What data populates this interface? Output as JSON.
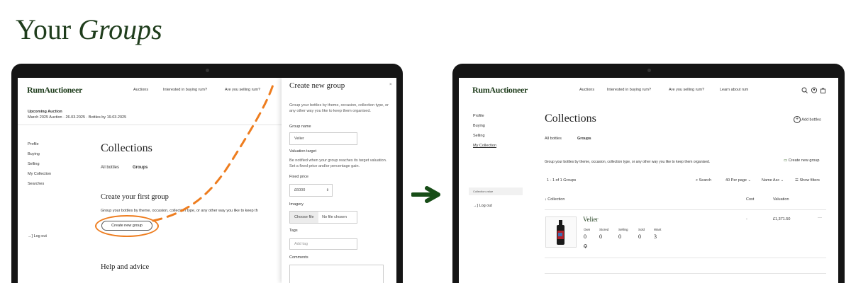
{
  "heading": {
    "plain": "Your",
    "italic": "Groups"
  },
  "left": {
    "logo": "RumAuctioneer",
    "nav": [
      "Auctions",
      "Interested in buying rum?",
      "Are you selling rum?"
    ],
    "upcoming": {
      "label": "Upcoming Auction",
      "detail": "March 2025 Auction  ·  26.03.2025  ·  Bottles by 19.03.2025"
    },
    "sidebar": [
      "Profile",
      "Buying",
      "Selling",
      "My Collection",
      "Searches"
    ],
    "logout": "Log out",
    "title": "Collections",
    "tabs": [
      "All bottles",
      "Groups"
    ],
    "empty_title": "Create your first group",
    "empty_desc": "Group your bottles by theme, occasion, collection type, or any other way you like to keep th",
    "create_button": "Create new group",
    "help_title": "Help and advice",
    "panel": {
      "title": "Create new group",
      "close": "×",
      "desc": [
        "Group your bottles by theme, occasion, collection type, or",
        "any other way you like to keep them organised."
      ],
      "group_name_label": "Group name",
      "group_name_value": "Velier",
      "valuation_label": "Valuation target",
      "valuation_desc": [
        "Be notified when your group reaches its target valuation.",
        "Set a fixed price and/or percentage gain."
      ],
      "fixed_price_label": "Fixed price",
      "fixed_price_value": "£6000",
      "imagery_label": "Imagery",
      "choose_file": "Choose file",
      "no_file": "No file chosen",
      "tags_label": "Tags",
      "tags_placeholder": "Add tag",
      "comments_label": "Comments"
    }
  },
  "right": {
    "logo": "RumAuctioneer",
    "nav": [
      "Auctions",
      "Interested in buying rum?",
      "Are you selling rum?",
      "Learn about rum"
    ],
    "sidebar": [
      "Profile",
      "Buying",
      "Selling",
      "My Collection"
    ],
    "sidebar_extra": "Collection value",
    "logout": "Log out",
    "title": "Collections",
    "add_bottles": "Add bottles",
    "tabs": [
      "All bottles",
      "Groups"
    ],
    "desc": "Group your bottles by theme, occasion, collection type, or any other way you like to keep them organised.",
    "create_group": "Create new group",
    "count": "1 - 1 of 1 Groups",
    "search": "Search",
    "per_page": "40 Per page",
    "sort": "Name Asc",
    "filters": "Show filters",
    "columns": {
      "collection": "↓ Collection",
      "cost": "Cost",
      "valuation": "Valuation"
    },
    "row": {
      "name": "Velier",
      "cost": "-",
      "valuation": "£1,371.50",
      "more": "···",
      "stats_labels": [
        "Own",
        "Stored",
        "Selling",
        "Sold",
        "Want"
      ],
      "stats_values": [
        "0",
        "0",
        "0",
        "0",
        "3"
      ]
    }
  },
  "colors": {
    "brand_green": "#1f3d1c",
    "orange": "#ee7d1f",
    "arrow_green": "#174d17"
  }
}
